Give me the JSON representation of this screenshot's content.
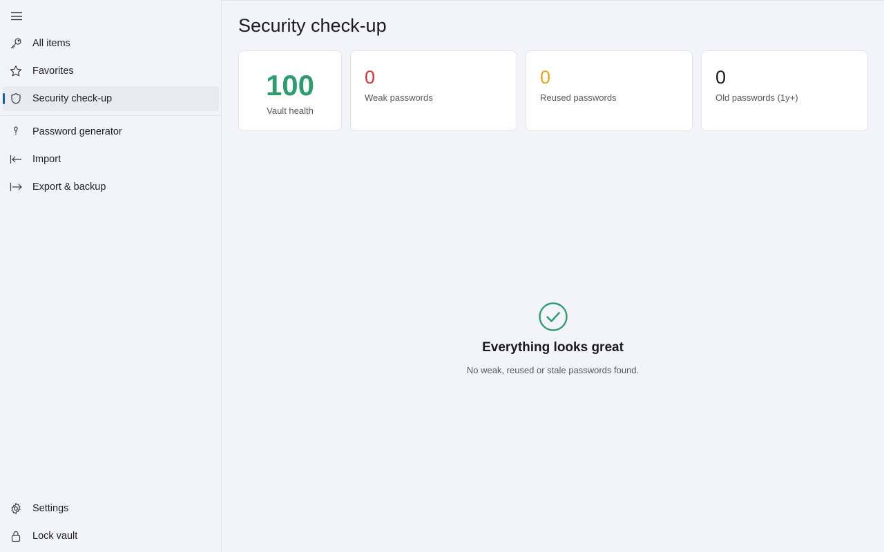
{
  "sidebar": {
    "menu_icon": "hamburger-icon",
    "items": [
      {
        "label": "All items",
        "icon": "key-icon"
      },
      {
        "label": "Favorites",
        "icon": "star-icon"
      },
      {
        "label": "Security check-up",
        "icon": "shield-icon",
        "active": true
      },
      {
        "label": "Password generator",
        "icon": "bulb-icon"
      },
      {
        "label": "Import",
        "icon": "import-icon"
      },
      {
        "label": "Export & backup",
        "icon": "export-icon"
      }
    ],
    "footer": [
      {
        "label": "Settings",
        "icon": "gear-icon"
      },
      {
        "label": "Lock vault",
        "icon": "lock-icon"
      }
    ]
  },
  "main": {
    "title": "Security check-up",
    "health": {
      "value": "100",
      "caption": "Vault health",
      "color": "#2e9d6d"
    },
    "stats": [
      {
        "value": "0",
        "caption": "Weak passwords",
        "color": "#d13438"
      },
      {
        "value": "0",
        "caption": "Reused passwords",
        "color": "#e8a416"
      },
      {
        "value": "0",
        "caption": "Old passwords (1y+)",
        "color": "#1b1b1f"
      }
    ],
    "empty_state": {
      "icon": "check-circle-icon",
      "heading": "Everything looks great",
      "message": "No weak, reused or stale passwords found."
    }
  },
  "colors": {
    "accent": "#0c5fb5",
    "success": "#2e9d6d"
  }
}
